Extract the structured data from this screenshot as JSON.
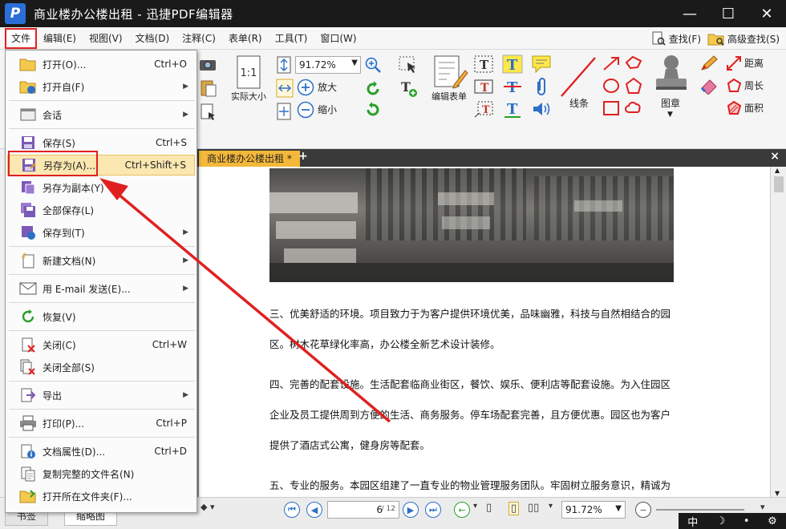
{
  "window": {
    "title": "商业楼办公楼出租 - 迅捷PDF编辑器",
    "logo_letter": "P",
    "minimize": "—",
    "maximize": "☐",
    "close": "✕"
  },
  "menubar": {
    "items": [
      "文件",
      "编辑(E)",
      "视图(V)",
      "文档(D)",
      "注释(C)",
      "表单(R)",
      "工具(T)",
      "窗口(W)"
    ],
    "find": "查找(F)",
    "advanced_find": "高级查找(S)"
  },
  "ribbon": {
    "zoom_value": "91.72%",
    "actual_size": "实际大小",
    "actual_size_icon_text": "1:1",
    "zoom_in": "放大",
    "zoom_out": "缩小",
    "edit_form": "编辑表单",
    "line": "线条",
    "stamp": "图章",
    "distance": "距离",
    "perimeter": "周长",
    "area": "面积"
  },
  "tabs": {
    "doc_tab": "商业楼办公楼出租 *",
    "close": "×",
    "add": "+"
  },
  "document": {
    "paragraphs": [
      "三、优美舒适的环境。项目致力于为客户提供环境优美，品味幽雅，科技与自然相结合的园",
      "区。树木花草绿化率高，办公楼全新艺术设计装修。",
      "四、完善的配套设施。生活配套临商业街区，餐饮、娱乐、便利店等配套设施。为入住园区",
      "企业及员工提供周到方便的生活、商务服务。停车场配套完善，且方便优惠。园区也为客户",
      "提供了酒店式公寓，健身房等配套。",
      "五、专业的服务。本园区组建了一直专业的物业管理服务团队。牢固树立服务意识，精诚为"
    ]
  },
  "statusbar": {
    "current_page": "6",
    "total_pages": "/ 12",
    "zoom": "91.72%",
    "side_tabs": [
      "书签",
      "缩略图"
    ],
    "ime": [
      "中",
      "☽",
      "•",
      "⚙"
    ]
  },
  "file_menu": {
    "items": [
      {
        "label": "打开(O)...",
        "shortcut": "Ctrl+O",
        "submenu": ""
      },
      {
        "label": "打开自(F)",
        "shortcut": "",
        "submenu": "▶"
      },
      {
        "label": "会话",
        "shortcut": "",
        "submenu": "▶"
      },
      {
        "label": "保存(S)",
        "shortcut": "Ctrl+S",
        "submenu": ""
      },
      {
        "label": "另存为(A)...",
        "shortcut": "Ctrl+Shift+S",
        "submenu": ""
      },
      {
        "label": "另存为副本(Y)",
        "shortcut": "",
        "submenu": ""
      },
      {
        "label": "全部保存(L)",
        "shortcut": "",
        "submenu": ""
      },
      {
        "label": "保存到(T)",
        "shortcut": "",
        "submenu": "▶"
      },
      {
        "label": "新建文档(N)",
        "shortcut": "",
        "submenu": "▶"
      },
      {
        "label": "用 E-mail 发送(E)...",
        "shortcut": "",
        "submenu": "▶"
      },
      {
        "label": "恢复(V)",
        "shortcut": "",
        "submenu": ""
      },
      {
        "label": "关闭(C)",
        "shortcut": "Ctrl+W",
        "submenu": ""
      },
      {
        "label": "关闭全部(S)",
        "shortcut": "",
        "submenu": ""
      },
      {
        "label": "导出",
        "shortcut": "",
        "submenu": "▶"
      },
      {
        "label": "打印(P)...",
        "shortcut": "Ctrl+P",
        "submenu": ""
      },
      {
        "label": "文档属性(D)...",
        "shortcut": "Ctrl+D",
        "submenu": ""
      },
      {
        "label": "复制完整的文件名(N)",
        "shortcut": "",
        "submenu": ""
      },
      {
        "label": "打开所在文件夹(F)...",
        "shortcut": "",
        "submenu": ""
      }
    ]
  },
  "colors": {
    "annotation_red": "#e02020",
    "highlight": "#fbe7b0",
    "accent_blue": "#2d6fc7",
    "tab_orange": "#f4b83a"
  }
}
